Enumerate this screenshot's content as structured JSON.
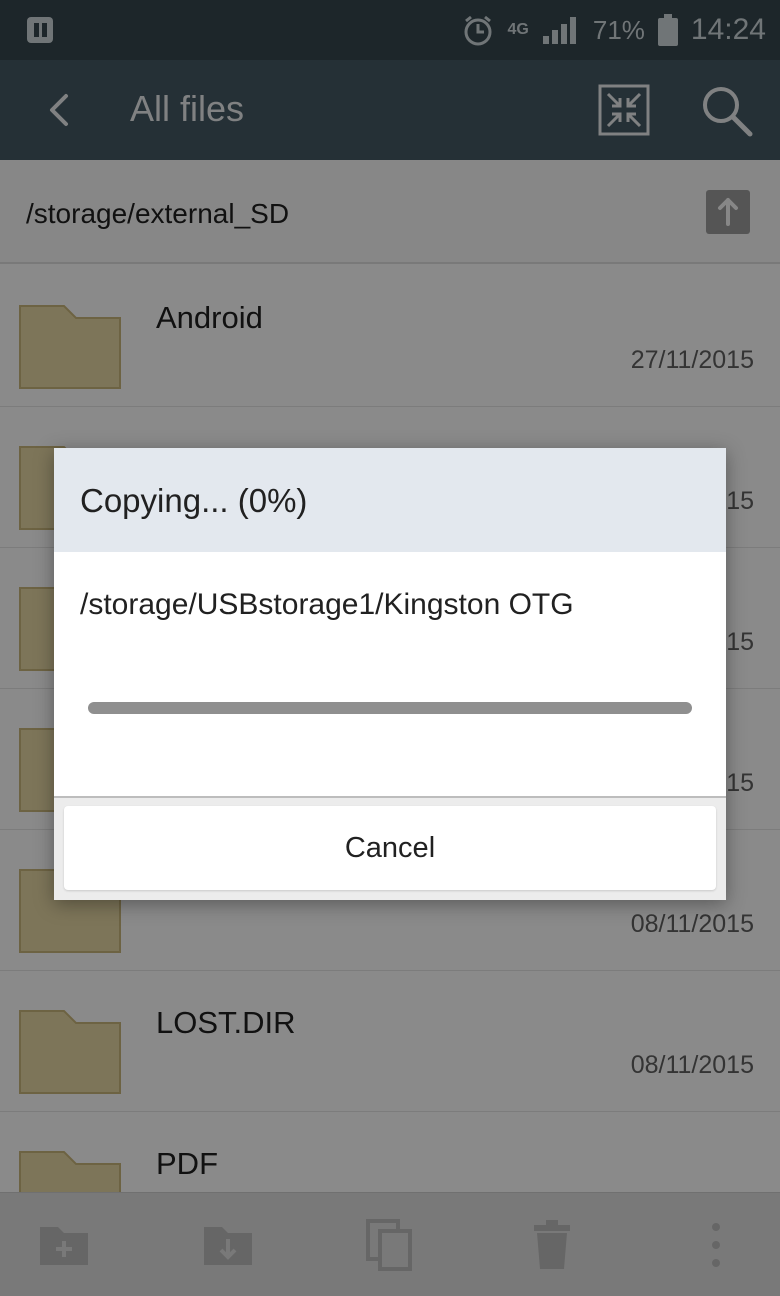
{
  "status_bar": {
    "network_label": "4G",
    "battery_percent": "71%",
    "time": "14:24"
  },
  "app_bar": {
    "title": "All files"
  },
  "path_bar": {
    "path": "/storage/external_SD"
  },
  "files": [
    {
      "name": "Android",
      "date": "27/11/2015"
    },
    {
      "name": "",
      "date": "15"
    },
    {
      "name": "",
      "date": "15"
    },
    {
      "name": "",
      "date": "15"
    },
    {
      "name": "",
      "date": "08/11/2015"
    },
    {
      "name": "LOST.DIR",
      "date": "08/11/2015"
    },
    {
      "name": "PDF",
      "date": ""
    }
  ],
  "dialog": {
    "title": "Copying... (0%)",
    "path": "/storage/USBstorage1/Kingston OTG",
    "progress_fraction": 0,
    "cancel_label": "Cancel"
  },
  "colors": {
    "status_bar": "#37474f",
    "app_bar": "#455a64",
    "folder": "#e8d9a4",
    "dialog_title_bg": "#e3e8ee"
  },
  "toolbar_icons": [
    "new-folder-icon",
    "move-icon",
    "copy-icon",
    "delete-icon",
    "more-icon"
  ]
}
